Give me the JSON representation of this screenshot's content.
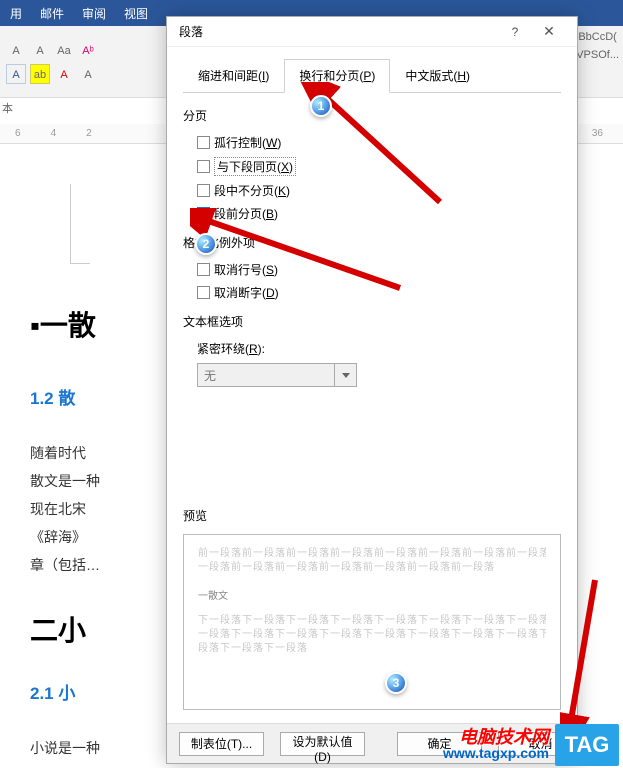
{
  "ribbon": {
    "tabs": [
      "用",
      "邮件",
      "审阅",
      "视图"
    ]
  },
  "toolbar": {
    "corner_label": "本",
    "styles_1": "BbCcD(",
    "styles_2": "VPSOf..."
  },
  "ruler": {
    "marks_left": [
      "6",
      "4",
      "2"
    ],
    "marks_right": [
      "36"
    ]
  },
  "doc": {
    "headline1": "▪一散",
    "sub12": "1.2 散",
    "body": "随着时代                                                                       的影响。\n散文是一种                                                                       词大约出\n现在北宋ᅟ\n《辞海》                                                                       的散体文\n章（包括…",
    "headline2": "二小",
    "sub21": "2.1 小",
    "body2": "小说是一种"
  },
  "dialog": {
    "title": "段落",
    "help": "?",
    "close": "✕",
    "tabs": {
      "indent": {
        "label": "缩进和间距(",
        "u": "I",
        "tail": ")"
      },
      "page": {
        "label": "换行和分页(",
        "u": "P",
        "tail": ")"
      },
      "cjk": {
        "label": "中文版式(",
        "u": "H",
        "tail": ")"
      }
    },
    "section_paging": "分页",
    "options": {
      "orphan": {
        "label": "孤行控制(",
        "u": "W",
        "tail": ")"
      },
      "keepnext": {
        "label": "与下段同页(",
        "u": "X",
        "tail": ")"
      },
      "keeptog": {
        "label": "段中不分页(",
        "u": "K",
        "tail": ")"
      },
      "pagebrk": {
        "label": "段前分页(",
        "u": "B",
        "tail": ")"
      }
    },
    "section_format_exception": "格式化例外项",
    "options2": {
      "nolinenum": {
        "label": "取消行号(",
        "u": "S",
        "tail": ")"
      },
      "nohyph": {
        "label": "取消断字(",
        "u": "D",
        "tail": ")"
      }
    },
    "section_textbox": "文本框选项",
    "tightwrap_label": "紧密环绕(",
    "tightwrap_u": "R",
    "tightwrap_tail": "):",
    "tightwrap_value": "无",
    "section_preview": "预览",
    "preview_sample": "一散文",
    "preview_gray_top1": "前一段落前一段落前一段落前一段落前一段落前一段落前一段落前一段落前一段落前一段落前一段落前",
    "preview_gray_top2": "一段落前一段落前一段落前一段落前一段落前一段落前一段落",
    "preview_gray_bot1": "下一段落下一段落下一段落下一段落下一段落下一段落下一段落下一段落下一段落下一段落下一段落下",
    "preview_gray_bot2": "一段落下一段落下一段落下一段落下一段落下一段落下一段落下一段落下一段落下一段落下一段落下一",
    "preview_gray_bot3": "段落下一段落下一段落",
    "buttons": {
      "tabsbtn": "制表位(T)...",
      "defaultbtn": "设为默认值(D)",
      "ok": "确定",
      "cancel": "取消"
    }
  },
  "annotations": {
    "b1": "1",
    "b2": "2",
    "b3": "3"
  },
  "watermark": {
    "line1": "电脑技术网",
    "line2": "www.tagxp.com",
    "tag": "TAG"
  }
}
